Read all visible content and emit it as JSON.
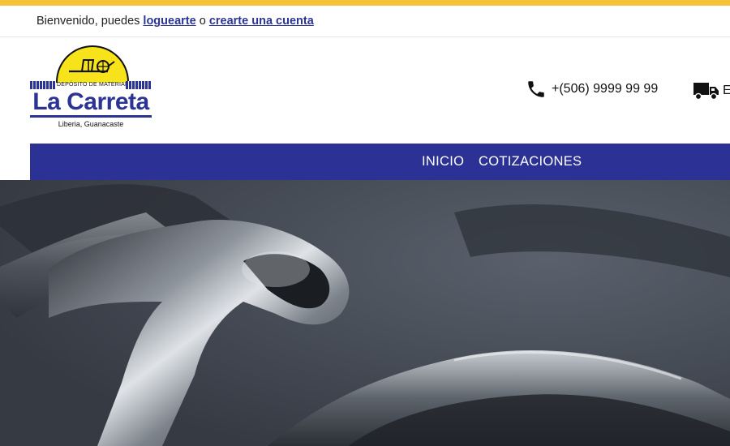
{
  "header": {
    "welcome_prefix": "Bienvenido, puedes",
    "login_link": "loguearte",
    "conjunction": "o",
    "register_link": "crearte una cuenta"
  },
  "logo": {
    "band_text": "DEPÓSITO DE MATERIALES",
    "name": "La Carreta",
    "place": "Liberia, Guanacaste"
  },
  "contact": {
    "phone": "+(506) 9999 99 99",
    "delivery_partial": "E"
  },
  "nav": {
    "items": [
      "INICIO",
      "COTIZACIONES"
    ]
  },
  "colors": {
    "accent_yellow": "#f6c338",
    "brand_blue": "#2c3295"
  }
}
